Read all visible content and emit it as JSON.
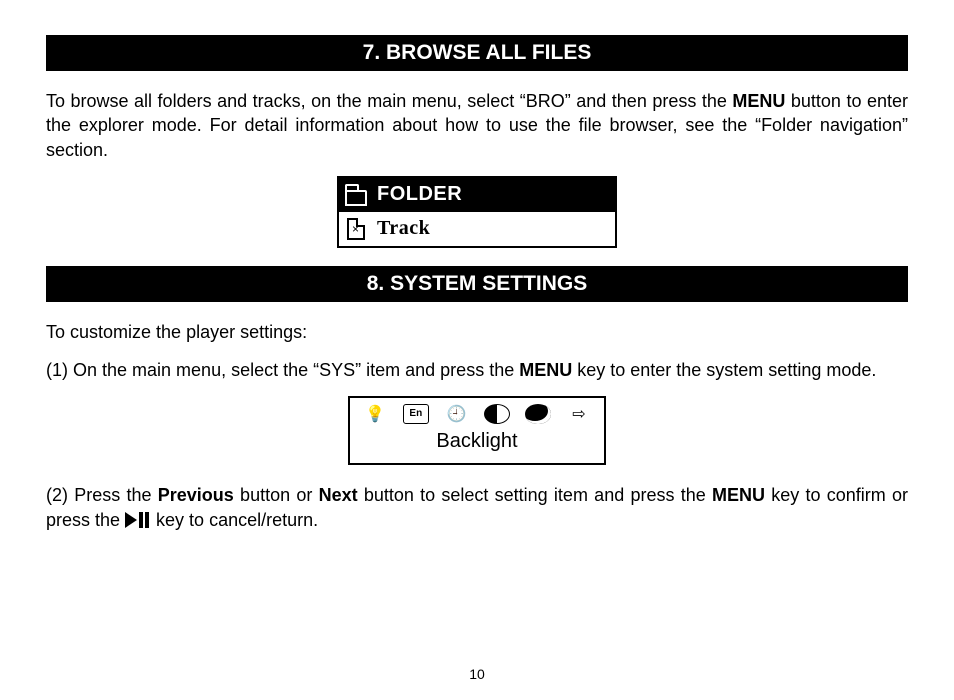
{
  "section7": {
    "heading": "7. BROWSE ALL FILES",
    "para_before": "To browse all folders and tracks, on the main menu, select “BRO” and then press the ",
    "menu_bold": "MENU",
    "para_after": " button to enter the explorer mode. For detail information about how to use the file browser, see the “Folder navigation” section.",
    "lcd": {
      "folder_label": "FOLDER",
      "track_label": "Track"
    }
  },
  "section8": {
    "heading": "8. SYSTEM SETTINGS",
    "intro": "To customize the player settings:",
    "step1_before": "(1) On the main menu, select the “SYS” item and press the ",
    "step1_bold": "MENU",
    "step1_after": " key to enter the system setting mode.",
    "lcd": {
      "icons": {
        "en": "En"
      },
      "caption": "Backlight"
    },
    "step2_a": "(2) Press the ",
    "step2_prev": "Previous",
    "step2_b": " button or ",
    "step2_next": "Next",
    "step2_c": " button to select setting item and press the ",
    "step2_menu": "MENU",
    "step2_d": " key to confirm or press the ",
    "step2_e": " key to cancel/return."
  },
  "page_number": "10"
}
